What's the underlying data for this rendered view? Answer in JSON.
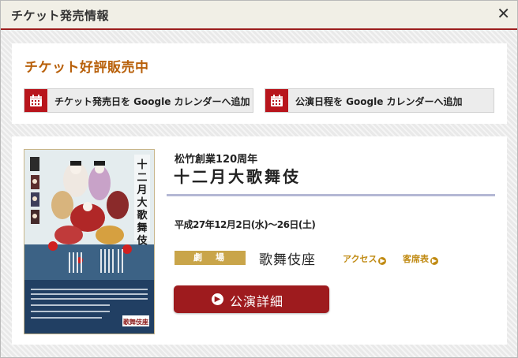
{
  "modal": {
    "title": "チケット発売情報",
    "close_label": "✕"
  },
  "sale": {
    "status": "チケット好評販売中",
    "buttons": [
      {
        "label": "チケット発売日を Google カレンダーへ追加",
        "icon": "calendar-icon"
      },
      {
        "label": "公演日程を Google カレンダーへ追加",
        "icon": "calendar-icon"
      }
    ]
  },
  "performance": {
    "subtitle": "松竹創業120周年",
    "title": "十二月大歌舞伎",
    "dates": "平成27年12月2日(水)～26日(土)",
    "venue_label": "劇　場",
    "venue_name": "歌舞伎座",
    "links": [
      {
        "label": "アクセス",
        "icon": "arrow-right-circle-icon"
      },
      {
        "label": "客席表",
        "icon": "arrow-right-circle-icon"
      }
    ],
    "detail_button": "公演詳細",
    "detail_icon": "arrow-right-circle-icon",
    "poster": {
      "vertical_title": "十二月大歌舞伎",
      "theatre_logo": "歌舞伎座"
    }
  },
  "colors": {
    "accent_red": "#9e1b1e",
    "status_orange": "#b8600a",
    "venue_gold": "#c9a54a",
    "rule_lavender": "#b4b8d4"
  }
}
